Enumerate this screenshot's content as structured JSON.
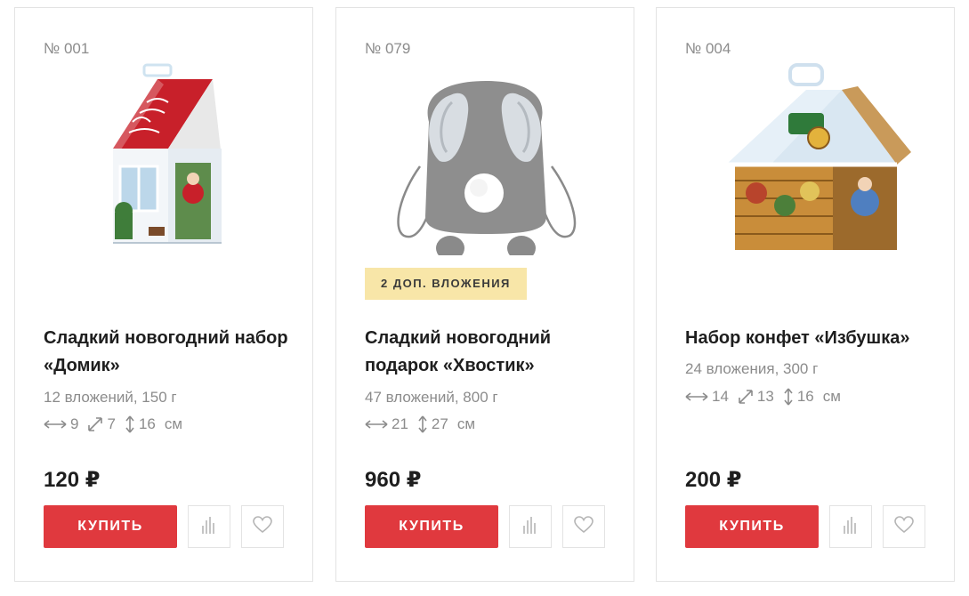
{
  "products": [
    {
      "sku": "№ 001",
      "badge": "",
      "title": "Сладкий новогодний набор «Домик»",
      "meta": "12 вложений, 150 г",
      "dims": [
        "9",
        "7",
        "16",
        "см"
      ],
      "price": "120 ₽",
      "buy_label": "КУПИТЬ",
      "image": "house-gift-box"
    },
    {
      "sku": "№ 079",
      "badge": "2 ДОП. ВЛОЖЕНИЯ",
      "title": "Сладкий новогодний подарок «Хвостик»",
      "meta": "47 вложений, 800 г",
      "dims": [
        "21",
        "27",
        "см"
      ],
      "price": "960 ₽",
      "buy_label": "КУПИТЬ",
      "image": "bunny-backpack"
    },
    {
      "sku": "№ 004",
      "badge": "",
      "title": "Набор конфет «Избушка»",
      "meta": "24 вложения, 300 г",
      "dims": [
        "14",
        "13",
        "16",
        "см"
      ],
      "price": "200 ₽",
      "buy_label": "КУПИТЬ",
      "image": "hut-gift-box"
    }
  ],
  "icons": {
    "width": "arrows-horizontal-icon",
    "depth": "arrows-diagonal-icon",
    "height": "arrows-vertical-icon",
    "compare": "bar-chart-icon",
    "favorite": "heart-icon"
  },
  "colors": {
    "buy_button": "#e0393e",
    "badge_bg": "#f8e6a8",
    "muted_text": "#8c8c8c",
    "border": "#e3e3e3"
  }
}
